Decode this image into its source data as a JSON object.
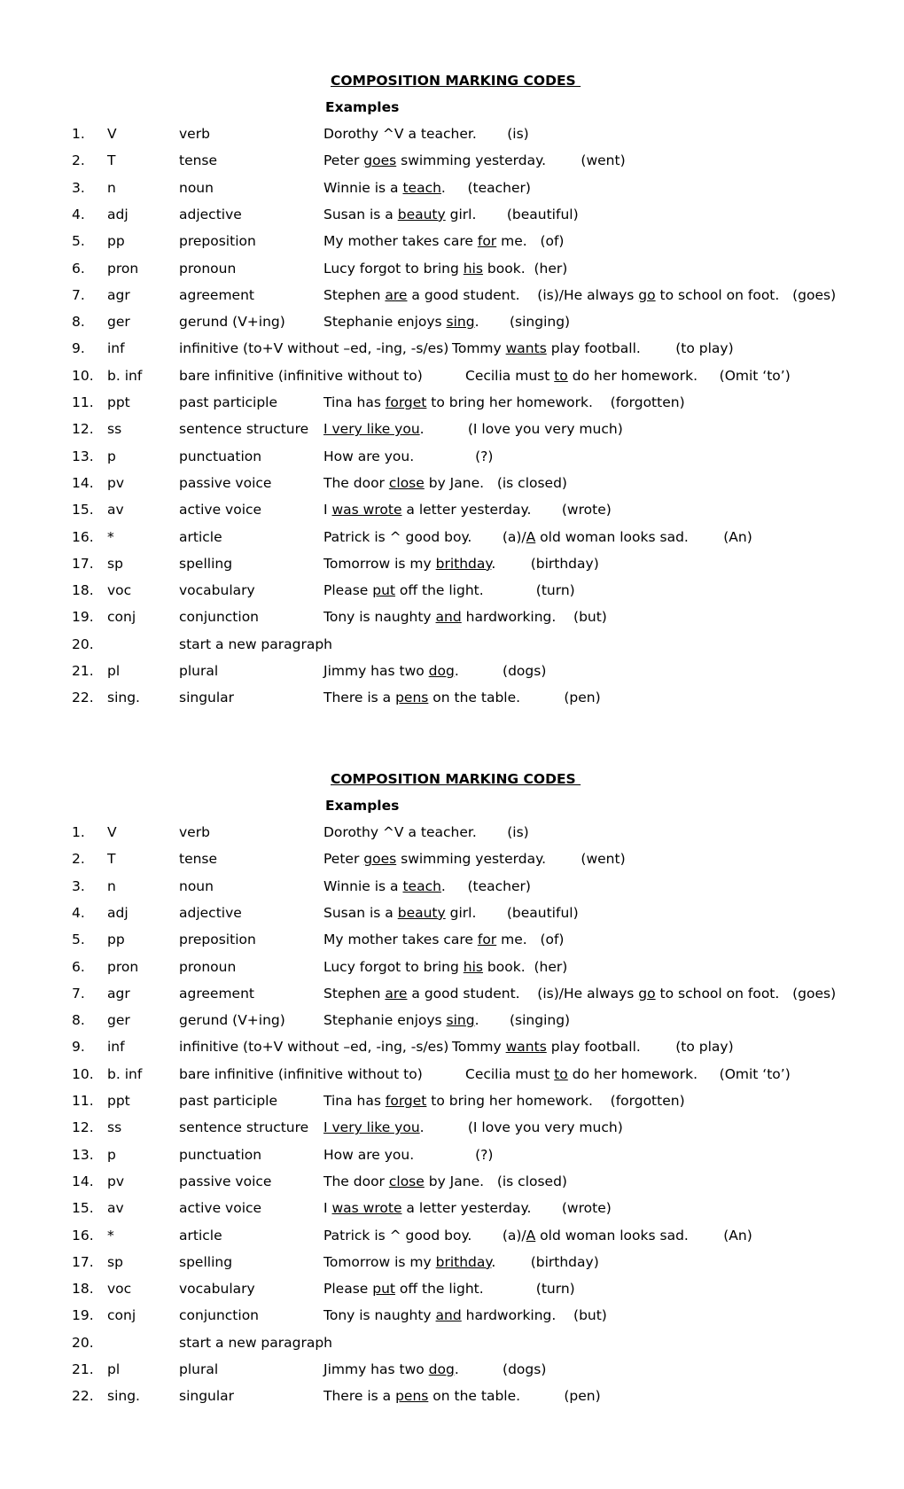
{
  "sections": [
    {
      "title": "COMPOSITION MARKING CODES ",
      "subtitle": "Examples",
      "rows": [
        {
          "num": "1.",
          "code": "V",
          "meaning": "verb",
          "example": [
            {
              "t": "Dorothy ^V a teacher.       (is)"
            }
          ]
        },
        {
          "num": "2.",
          "code": "T",
          "meaning": "tense",
          "example": [
            {
              "t": "Peter "
            },
            {
              "t": "goes",
              "u": true
            },
            {
              "t": " swimming yesterday.        (went)"
            }
          ]
        },
        {
          "num": "3.",
          "code": "n",
          "meaning": "noun",
          "example": [
            {
              "t": "Winnie is a "
            },
            {
              "t": "teach",
              "u": true
            },
            {
              "t": ".     (teacher)"
            }
          ]
        },
        {
          "num": "4.",
          "code": "adj",
          "meaning": "adjective",
          "example": [
            {
              "t": "Susan is a "
            },
            {
              "t": "beauty",
              "u": true
            },
            {
              "t": " girl.       (beautiful)"
            }
          ]
        },
        {
          "num": "5.",
          "code": "pp",
          "meaning": "preposition",
          "example": [
            {
              "t": "My mother takes care "
            },
            {
              "t": "for",
              "u": true
            },
            {
              "t": " me.   (of)"
            }
          ]
        },
        {
          "num": "6.",
          "code": "pron",
          "meaning": "pronoun",
          "example": [
            {
              "t": "Lucy forgot to bring "
            },
            {
              "t": "his",
              "u": true
            },
            {
              "t": " book.  (her)"
            }
          ]
        },
        {
          "num": "7.",
          "code": "agr",
          "meaning": "agreement",
          "example": [
            {
              "t": "Stephen "
            },
            {
              "t": "are",
              "u": true
            },
            {
              "t": " a good student.    (is)/He always "
            },
            {
              "t": "go",
              "u": true
            },
            {
              "t": " to school on foot.   (goes)"
            }
          ]
        },
        {
          "num": "8.",
          "code": "ger",
          "meaning": "gerund (V+ing)",
          "example": [
            {
              "t": "Stephanie enjoys "
            },
            {
              "t": "sing",
              "u": true
            },
            {
              "t": ".       (singing)"
            }
          ]
        },
        {
          "num": "9.",
          "code": "inf",
          "meaning": "infinitive (to+V without –ed, -ing, -s/es)",
          "example": [
            {
              "t": "   Tommy "
            },
            {
              "t": "wants",
              "u": true
            },
            {
              "t": " play football.        (to play)"
            }
          ],
          "shift": true
        },
        {
          "num": "10.",
          "code": "b. inf",
          "meaning": "bare infinitive (infinitive without to)",
          "example": [
            {
              "t": "        Cecilia must "
            },
            {
              "t": "to",
              "u": true
            },
            {
              "t": " do her homework.     (Omit ‘to’)"
            }
          ],
          "shift": true
        },
        {
          "num": "11.",
          "code": "ppt",
          "meaning": "past participle",
          "example": [
            {
              "t": "Tina has "
            },
            {
              "t": "forget",
              "u": true
            },
            {
              "t": " to bring her homework.    (forgotten)"
            }
          ]
        },
        {
          "num": "12.",
          "code": "ss",
          "meaning": "sentence structure",
          "example": [
            {
              "t": "I very like you",
              "u": true
            },
            {
              "t": ".          (I love you very much)"
            }
          ]
        },
        {
          "num": "13.",
          "code": "p",
          "meaning": "punctuation",
          "example": [
            {
              "t": "How are you.              (?)"
            }
          ]
        },
        {
          "num": "14.",
          "code": "pv",
          "meaning": "passive voice",
          "example": [
            {
              "t": "The door "
            },
            {
              "t": "close",
              "u": true
            },
            {
              "t": " by Jane.   (is closed)"
            }
          ]
        },
        {
          "num": "15.",
          "code": "av",
          "meaning": "active voice",
          "example": [
            {
              "t": "I "
            },
            {
              "t": "was wrote",
              "u": true
            },
            {
              "t": " a letter yesterday.       (wrote)"
            }
          ]
        },
        {
          "num": "16.",
          "code": "*",
          "meaning": "article",
          "example": [
            {
              "t": "Patrick is ^ good boy.       (a)/"
            },
            {
              "t": "A",
              "u": true
            },
            {
              "t": " old woman looks sad.        (An)"
            }
          ]
        },
        {
          "num": "17.",
          "code": "sp",
          "meaning": "spelling",
          "example": [
            {
              "t": "Tomorrow is my "
            },
            {
              "t": "brithday",
              "u": true
            },
            {
              "t": ".        (birthday)"
            }
          ]
        },
        {
          "num": "18.",
          "code": "voc",
          "meaning": "vocabulary",
          "example": [
            {
              "t": "Please "
            },
            {
              "t": "put",
              "u": true
            },
            {
              "t": " off the light.            (turn)"
            }
          ]
        },
        {
          "num": "19.",
          "code": "conj",
          "meaning": "conjunction",
          "example": [
            {
              "t": "Tony is naughty "
            },
            {
              "t": "and",
              "u": true
            },
            {
              "t": " hardworking.    (but)"
            }
          ]
        },
        {
          "num": "20.",
          "code": "",
          "meaning": " start a new paragraph",
          "example": []
        },
        {
          "num": "21.",
          "code": "pl",
          "meaning": "plural",
          "example": [
            {
              "t": "Jimmy has two "
            },
            {
              "t": "dog",
              "u": true
            },
            {
              "t": ".          (dogs)"
            }
          ]
        },
        {
          "num": "22.",
          "code": "sing.",
          "meaning": "singular",
          "example": [
            {
              "t": "There is a "
            },
            {
              "t": "pens",
              "u": true
            },
            {
              "t": " on the table.          (pen)"
            }
          ]
        }
      ]
    }
  ]
}
